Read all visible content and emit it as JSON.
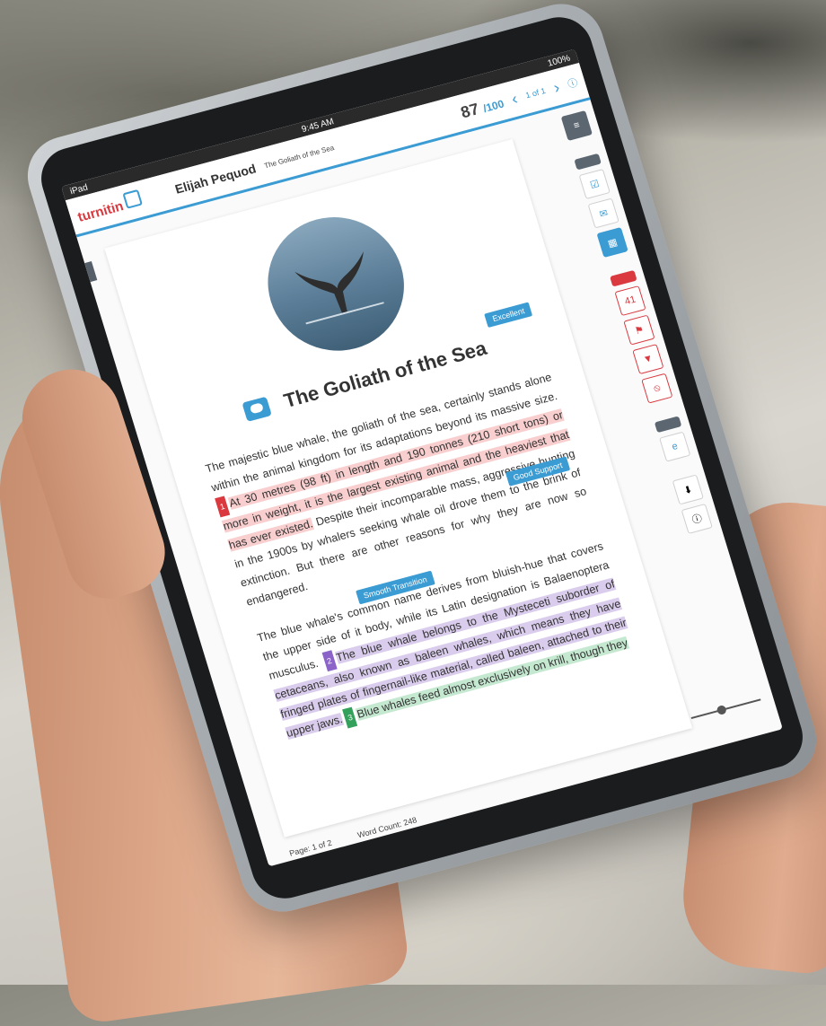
{
  "status": {
    "device": "iPad",
    "time": "9:45 AM",
    "battery": "100%"
  },
  "header": {
    "logo": "turnitin",
    "author": "Elijah Pequod",
    "doc_title": "The Goliath of the Sea",
    "score": "87",
    "score_max": "/100",
    "pager": "1 of 1",
    "prev_icon": "chevron-left-icon",
    "next_icon": "chevron-right-icon"
  },
  "document": {
    "title": "The Goliath of the Sea",
    "tags": {
      "excellent": "Excellent",
      "good_support": "Good Support",
      "smooth_transition": "Smooth Transition"
    },
    "para1": {
      "pre": "The majestic blue whale, the goliath of the sea, certainly stands alone within the animal kingdom for its adaptations beyond its massive size. ",
      "match_num": "1",
      "match": "At 30 metres (98 ft) in length and 190 tonnes (210 short tons) or more in weight, it is the largest existing animal and the heaviest that has ever existed.",
      "post": " Despite their incomparable mass, aggressive hunting in the 1900s by whalers seeking whale oil drove them to the brink of extinction. But there are other reasons for why they are now so endangered."
    },
    "para2": {
      "pre": "The blue whale's common name derives from bluish-hue that covers the upper side of it body, while its Latin designation is Balaenoptera musculus. ",
      "match2_num": "2",
      "match2": "The blue whale belongs to the Mysteceti suborder of cetaceans, also known as baleen whales, which means they have fringed plates of fingernail-like material, called baleen, attached to their upper jaws.",
      "match3_num": "3",
      "match3": "Blue whales feed almost exclusively on krill, though they"
    },
    "footer": {
      "page": "Page: 1 of 2",
      "word_count": "Word Count: 248"
    }
  },
  "sidebar": {
    "similarity_count": "41",
    "icons": [
      "layers-icon",
      "rubric-icon",
      "comment-icon",
      "grid-icon",
      "flag-icon",
      "filter-icon",
      "block-icon",
      "ets-icon",
      "download-icon",
      "info-icon"
    ]
  }
}
